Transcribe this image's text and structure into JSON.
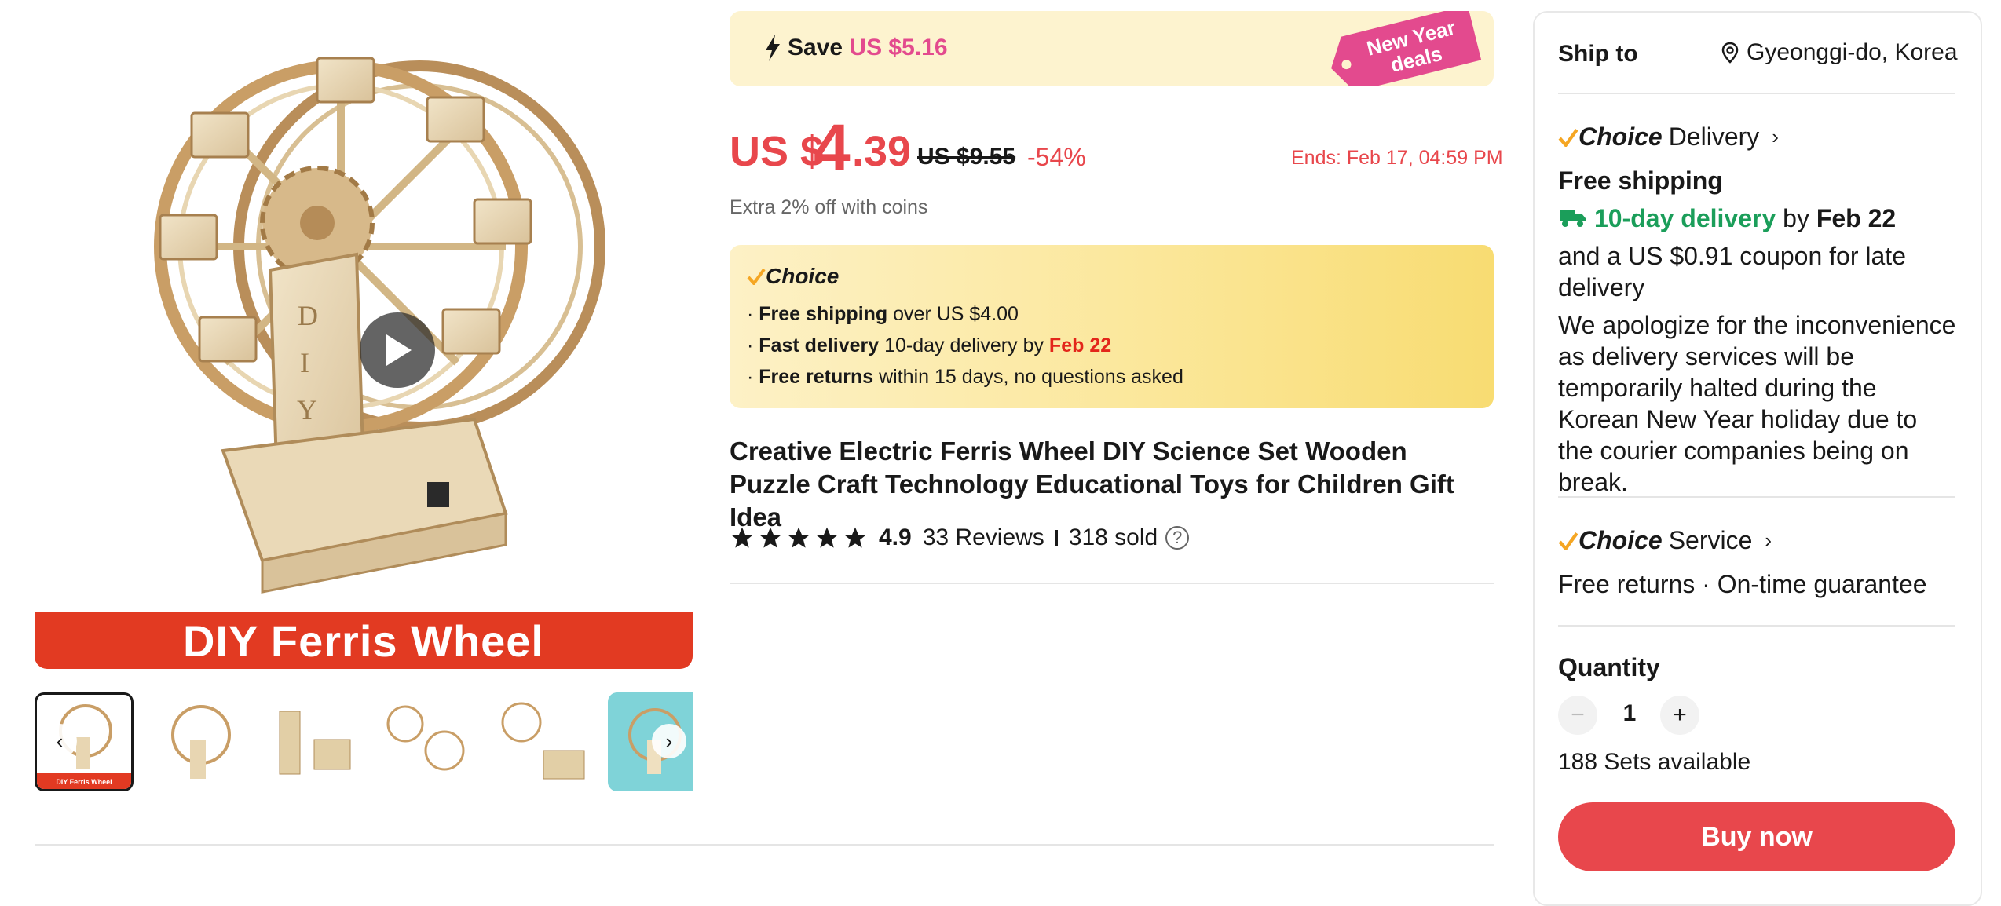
{
  "gallery": {
    "banner_text": "DIY Ferris Wheel",
    "letters": [
      "D",
      "I",
      "Y"
    ],
    "prev_arrow": "‹",
    "next_arrow": "›",
    "thumbnail_count": 6,
    "thumb_banner": "DIY Ferris Wheel"
  },
  "promo": {
    "save_label": "Save",
    "save_amount": "US $5.16",
    "tag_line1": "New Year",
    "tag_line2": "deals"
  },
  "price": {
    "currency": "US $",
    "whole": "4",
    "cents": ".39",
    "original": "US $9.55",
    "discount": "-54%",
    "ends": "Ends: Feb 17, 04:59 PM",
    "coins_note": "Extra 2% off with coins"
  },
  "choice_box": {
    "logo": "Choice",
    "bullet": "·",
    "line1_bold": "Free shipping",
    "line1_rest": " over US $4.00",
    "line2_bold": "Fast delivery",
    "line2_rest": " 10-day delivery by ",
    "line2_date": "Feb 22",
    "line3_bold": "Free returns",
    "line3_rest": "  within 15 days, no questions asked"
  },
  "product": {
    "title": "Creative Electric Ferris Wheel DIY Science Set Wooden Puzzle Craft Technology Educational Toys for Children Gift Idea",
    "rating": "4.9",
    "stars": 5,
    "reviews": "33 Reviews",
    "sold": "318 sold",
    "help": "?"
  },
  "shipping": {
    "ship_to_label": "Ship to",
    "location": "Gyeonggi-do, Korea",
    "choice_delivery_brand": "Choice",
    "choice_delivery_label": "Delivery",
    "free_shipping": "Free shipping",
    "delivery_days": "10-day delivery",
    "delivery_by": " by ",
    "delivery_date": "Feb 22",
    "coupon_note": "and a US $0.91 coupon for late delivery",
    "apology": "We apologize for the inconvenience as delivery services will be temporarily halted during the Korean New Year holiday due to the courier companies being on break.",
    "choice_service_brand": "Choice",
    "choice_service_label": "Service",
    "service_desc": "Free returns · On-time guarantee",
    "chevron": "›"
  },
  "quantity": {
    "label": "Quantity",
    "minus": "−",
    "value": "1",
    "plus": "+",
    "available": "188 Sets available"
  },
  "actions": {
    "buy_now": "Buy now"
  },
  "colors": {
    "price_red": "#e8474c",
    "promo_pink": "#e34a8e",
    "delivery_green": "#1b9e5a",
    "banner_red": "#e23a22",
    "choice_check": "#f5a623"
  },
  "icons": {
    "bolt": "lightning-icon",
    "location": "location-pin-icon",
    "check": "choice-check-icon",
    "truck": "truck-icon",
    "star": "star-icon",
    "play": "play-icon"
  }
}
